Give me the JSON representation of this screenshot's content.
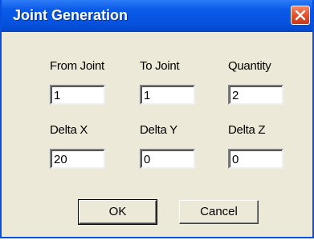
{
  "window": {
    "title": "Joint Generation",
    "close_icon": "close-icon"
  },
  "fields": {
    "from_joint": {
      "label": "From Joint",
      "value": "1"
    },
    "to_joint": {
      "label": "To Joint",
      "value": "1"
    },
    "quantity": {
      "label": "Quantity",
      "value": "2"
    },
    "delta_x": {
      "label": "Delta X",
      "value": "20"
    },
    "delta_y": {
      "label": "Delta Y",
      "value": "0"
    },
    "delta_z": {
      "label": "Delta Z",
      "value": "0"
    }
  },
  "buttons": {
    "ok": "OK",
    "cancel": "Cancel"
  },
  "colors": {
    "title_bar": "#0653e0",
    "close_button": "#e4512b",
    "dialog_face": "#ece9d8"
  }
}
